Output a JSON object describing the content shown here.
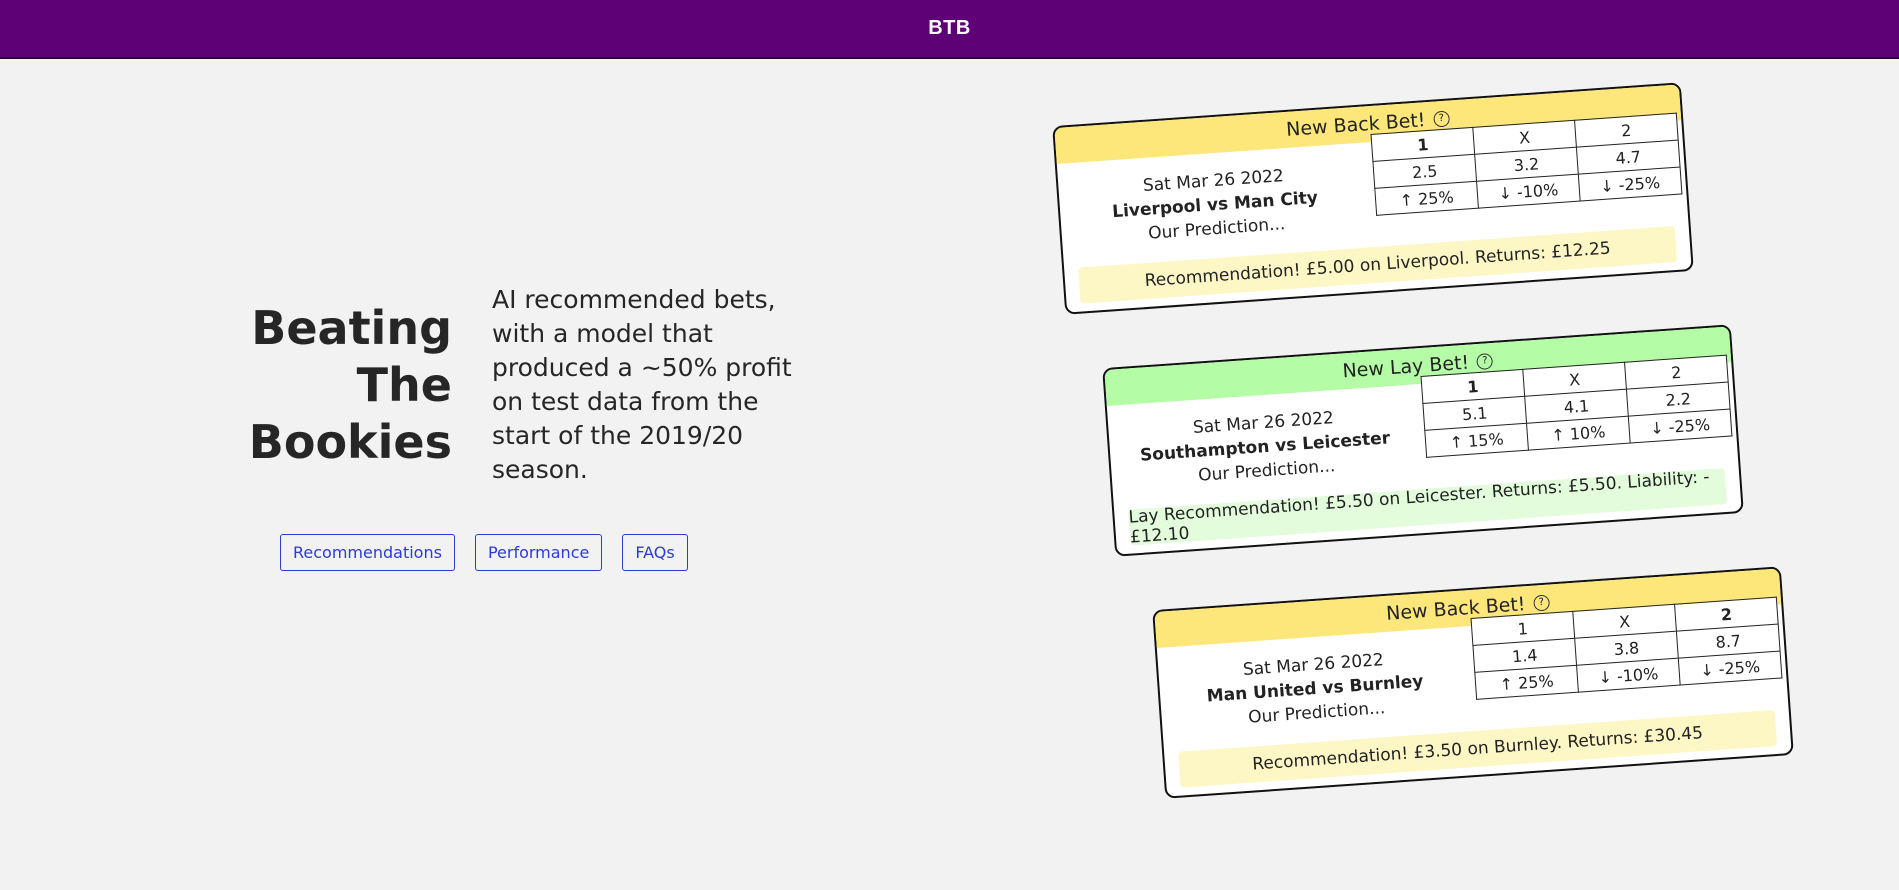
{
  "app": {
    "brand": "BTB"
  },
  "hero": {
    "title_lines": [
      "Beating",
      "The",
      "Bookies"
    ],
    "description": "AI recommended bets, with a model that produced a ~50% profit on test data from the start of the 2019/20 season."
  },
  "nav": {
    "recommendations": "Recommendations",
    "performance": "Performance",
    "faqs": "FAQs"
  },
  "colors": {
    "header_bg": "#5e0076",
    "back_header": "#fde67a",
    "back_footer": "#fdf7c6",
    "lay_header": "#b5fca7",
    "lay_footer": "#e2fcdc",
    "up_strong": "#4ff33f",
    "down_light": "#f59aa3",
    "down_strong": "#f4001e"
  },
  "help_icon": "question-circle-icon",
  "bets": [
    {
      "heading": "New Back Bet!",
      "date": "Sat Mar 26 2022",
      "match": "Liverpool vs Man City",
      "prediction_label": "Our Prediction...",
      "outcomes": [
        "1",
        "X",
        "2"
      ],
      "odds": [
        "2.5",
        "3.2",
        "4.7"
      ],
      "changes": [
        "↑ 25%",
        "↓ -10%",
        "↓ -25%"
      ],
      "recommendation": "Recommendation! £5.00 on Liverpool. Returns: £12.25"
    },
    {
      "heading": "New Lay Bet!",
      "date": "Sat Mar 26 2022",
      "match": "Southampton vs Leicester",
      "prediction_label": "Our Prediction...",
      "outcomes": [
        "1",
        "X",
        "2"
      ],
      "odds": [
        "5.1",
        "4.1",
        "2.2"
      ],
      "changes": [
        "↑ 15%",
        "↑ 10%",
        "↓ -25%"
      ],
      "recommendation": "Lay Recommendation! £5.50 on Leicester. Returns: £5.50. Liability: -£12.10"
    },
    {
      "heading": "New Back Bet!",
      "date": "Sat Mar 26 2022",
      "match": "Man United vs Burnley",
      "prediction_label": "Our Prediction...",
      "outcomes": [
        "1",
        "X",
        "2"
      ],
      "odds": [
        "1.4",
        "3.8",
        "8.7"
      ],
      "changes": [
        "↑ 25%",
        "↓ -10%",
        "↓ -25%"
      ],
      "recommendation": "Recommendation! £3.50 on Burnley. Returns: £30.45"
    }
  ]
}
